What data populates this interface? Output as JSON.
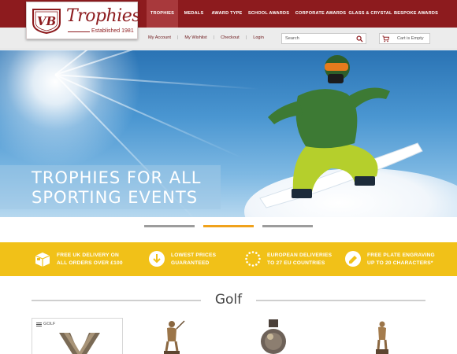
{
  "brand": {
    "initials": "VB",
    "name": "Trophies",
    "tagline": "Established 1981",
    "color": "#8d1b1e"
  },
  "nav": {
    "items": [
      {
        "label": "TROPHIES",
        "active": true
      },
      {
        "label": "MEDALS",
        "active": false
      },
      {
        "label": "AWARD TYPE",
        "active": false
      },
      {
        "label": "SCHOOL AWARDS",
        "active": false
      },
      {
        "label": "CORPORATE AWARDS",
        "active": false
      },
      {
        "label": "GLASS & CRYSTAL",
        "active": false
      },
      {
        "label": "BESPOKE AWARDS",
        "active": false
      }
    ]
  },
  "utility": {
    "my_account": "My Account",
    "my_wishlist": "My Wishlist",
    "checkout": "Checkout",
    "login": "Login",
    "separator": "|"
  },
  "search": {
    "placeholder": "Search",
    "icon": "search-icon"
  },
  "cart": {
    "label": "Cart is Empty",
    "icon": "cart-icon"
  },
  "hero": {
    "line1": "TROPHIES FOR ALL",
    "line2": "SPORTING EVENTS",
    "slides": 3,
    "active_slide": 2
  },
  "usps": [
    {
      "icon": "delivery-box-icon",
      "line1": "FREE UK DELIVERY ON",
      "line2": "ALL ORDERS OVER £100"
    },
    {
      "icon": "price-down-arrow-icon",
      "line1": "LOWEST PRICES",
      "line2": "GUARANTEED"
    },
    {
      "icon": "eu-stars-icon",
      "line1": "EUROPEAN DELIVERIES",
      "line2": "TO 27 EU COUNTRIES"
    },
    {
      "icon": "engraving-tag-icon",
      "line1": "FREE PLATE ENGRAVING",
      "line2": "UP TO 20 CHARACTERS*"
    }
  ],
  "section": {
    "title": "Golf",
    "card_tag": "GOLF"
  },
  "colors": {
    "header": "#8d1b1e",
    "active_nav": "#a8393c",
    "usp_band": "#f1c118",
    "accent": "#f0a21c"
  }
}
